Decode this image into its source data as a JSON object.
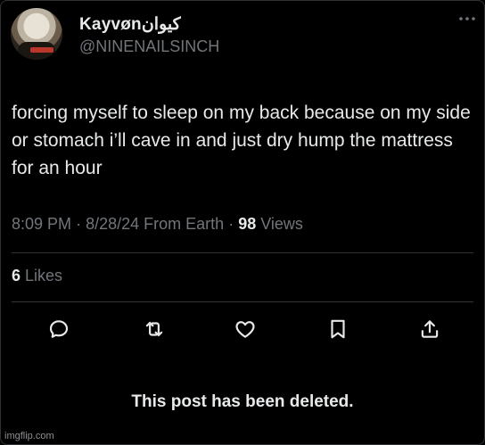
{
  "author": {
    "display_name": "Kayvønکیوان",
    "handle": "@NINENAILSINCH"
  },
  "post": {
    "text": "forcing myself to sleep on my back because on my side or stomach i’ll cave in and just dry hump the mattress for an hour",
    "time": "8:09 PM",
    "date": "8/28/24",
    "source": "From Earth",
    "views_count": "98",
    "views_label": "Views",
    "likes_count": "6",
    "likes_label": "Likes"
  },
  "actions": [
    {
      "name": "reply-icon"
    },
    {
      "name": "repost-icon"
    },
    {
      "name": "like-icon"
    },
    {
      "name": "bookmark-icon"
    },
    {
      "name": "share-icon"
    }
  ],
  "notice": "This post has been deleted.",
  "watermark": "imgflip.com",
  "colors": {
    "background": "#000000",
    "primary_text": "#e7e9ea",
    "secondary_text": "#71767b",
    "divider": "#2f3336"
  }
}
